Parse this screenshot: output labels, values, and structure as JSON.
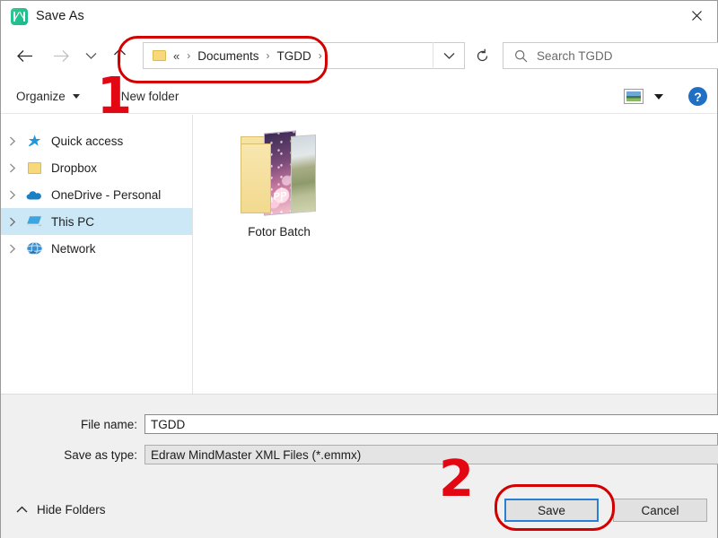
{
  "window": {
    "title": "Save As",
    "app_icon": "mindmaster-icon",
    "close_label": "✕"
  },
  "navigation": {
    "back_icon": "arrow-left-icon",
    "forward_icon": "arrow-right-icon",
    "recent_icon": "chevron-down-icon",
    "up_icon": "arrow-up-icon",
    "breadcrumb": {
      "folder_icon": "folder-icon",
      "lead": "«",
      "items": [
        "Documents",
        "TGDD"
      ],
      "separator": "›",
      "trailing_separator": "›",
      "dropdown_icon": "chevron-down-icon"
    },
    "refresh_icon": "refresh-icon",
    "search": {
      "icon": "search-icon",
      "placeholder": "Search TGDD",
      "value": ""
    }
  },
  "toolbar": {
    "organize_label": "Organize",
    "new_folder_label": "New folder",
    "view_icon": "view-thumbnails-icon",
    "view_caret_icon": "chevron-down-icon",
    "help_label": "?"
  },
  "nav_pane": {
    "items": [
      {
        "label": "Quick access",
        "icon": "star-icon",
        "selected": false
      },
      {
        "label": "Dropbox",
        "icon": "folder-icon",
        "selected": false
      },
      {
        "label": "OneDrive - Personal",
        "icon": "cloud-icon",
        "selected": false
      },
      {
        "label": "This PC",
        "icon": "computer-icon",
        "selected": true
      },
      {
        "label": "Network",
        "icon": "network-icon",
        "selected": false
      }
    ],
    "expand_icon": "chevron-right-icon"
  },
  "file_list": {
    "items": [
      {
        "name": "Fotor Batch",
        "type": "folder",
        "thumb_label": "APP"
      }
    ]
  },
  "form": {
    "file_name_label": "File name:",
    "file_name_value": "TGDD",
    "save_as_type_label": "Save as type:",
    "save_as_type_value": "Edraw MindMaster XML Files (*.emmx)",
    "save_as_type_caret": "chevron-down-icon"
  },
  "footer": {
    "hide_folders_label": "Hide Folders",
    "hide_folders_icon": "chevron-up-icon",
    "save_label": "Save",
    "cancel_label": "Cancel"
  },
  "annotations": {
    "step_one": "1",
    "step_two": "2",
    "color": "#e30613",
    "outline_color": "#d40000"
  },
  "colors": {
    "selection_blue": "#cce8f7",
    "focus_blue": "#2a7fd4",
    "help_blue": "#1f6fc4",
    "folder_yellow": "#f7d97b",
    "chrome_gray": "#f0f0f0"
  }
}
